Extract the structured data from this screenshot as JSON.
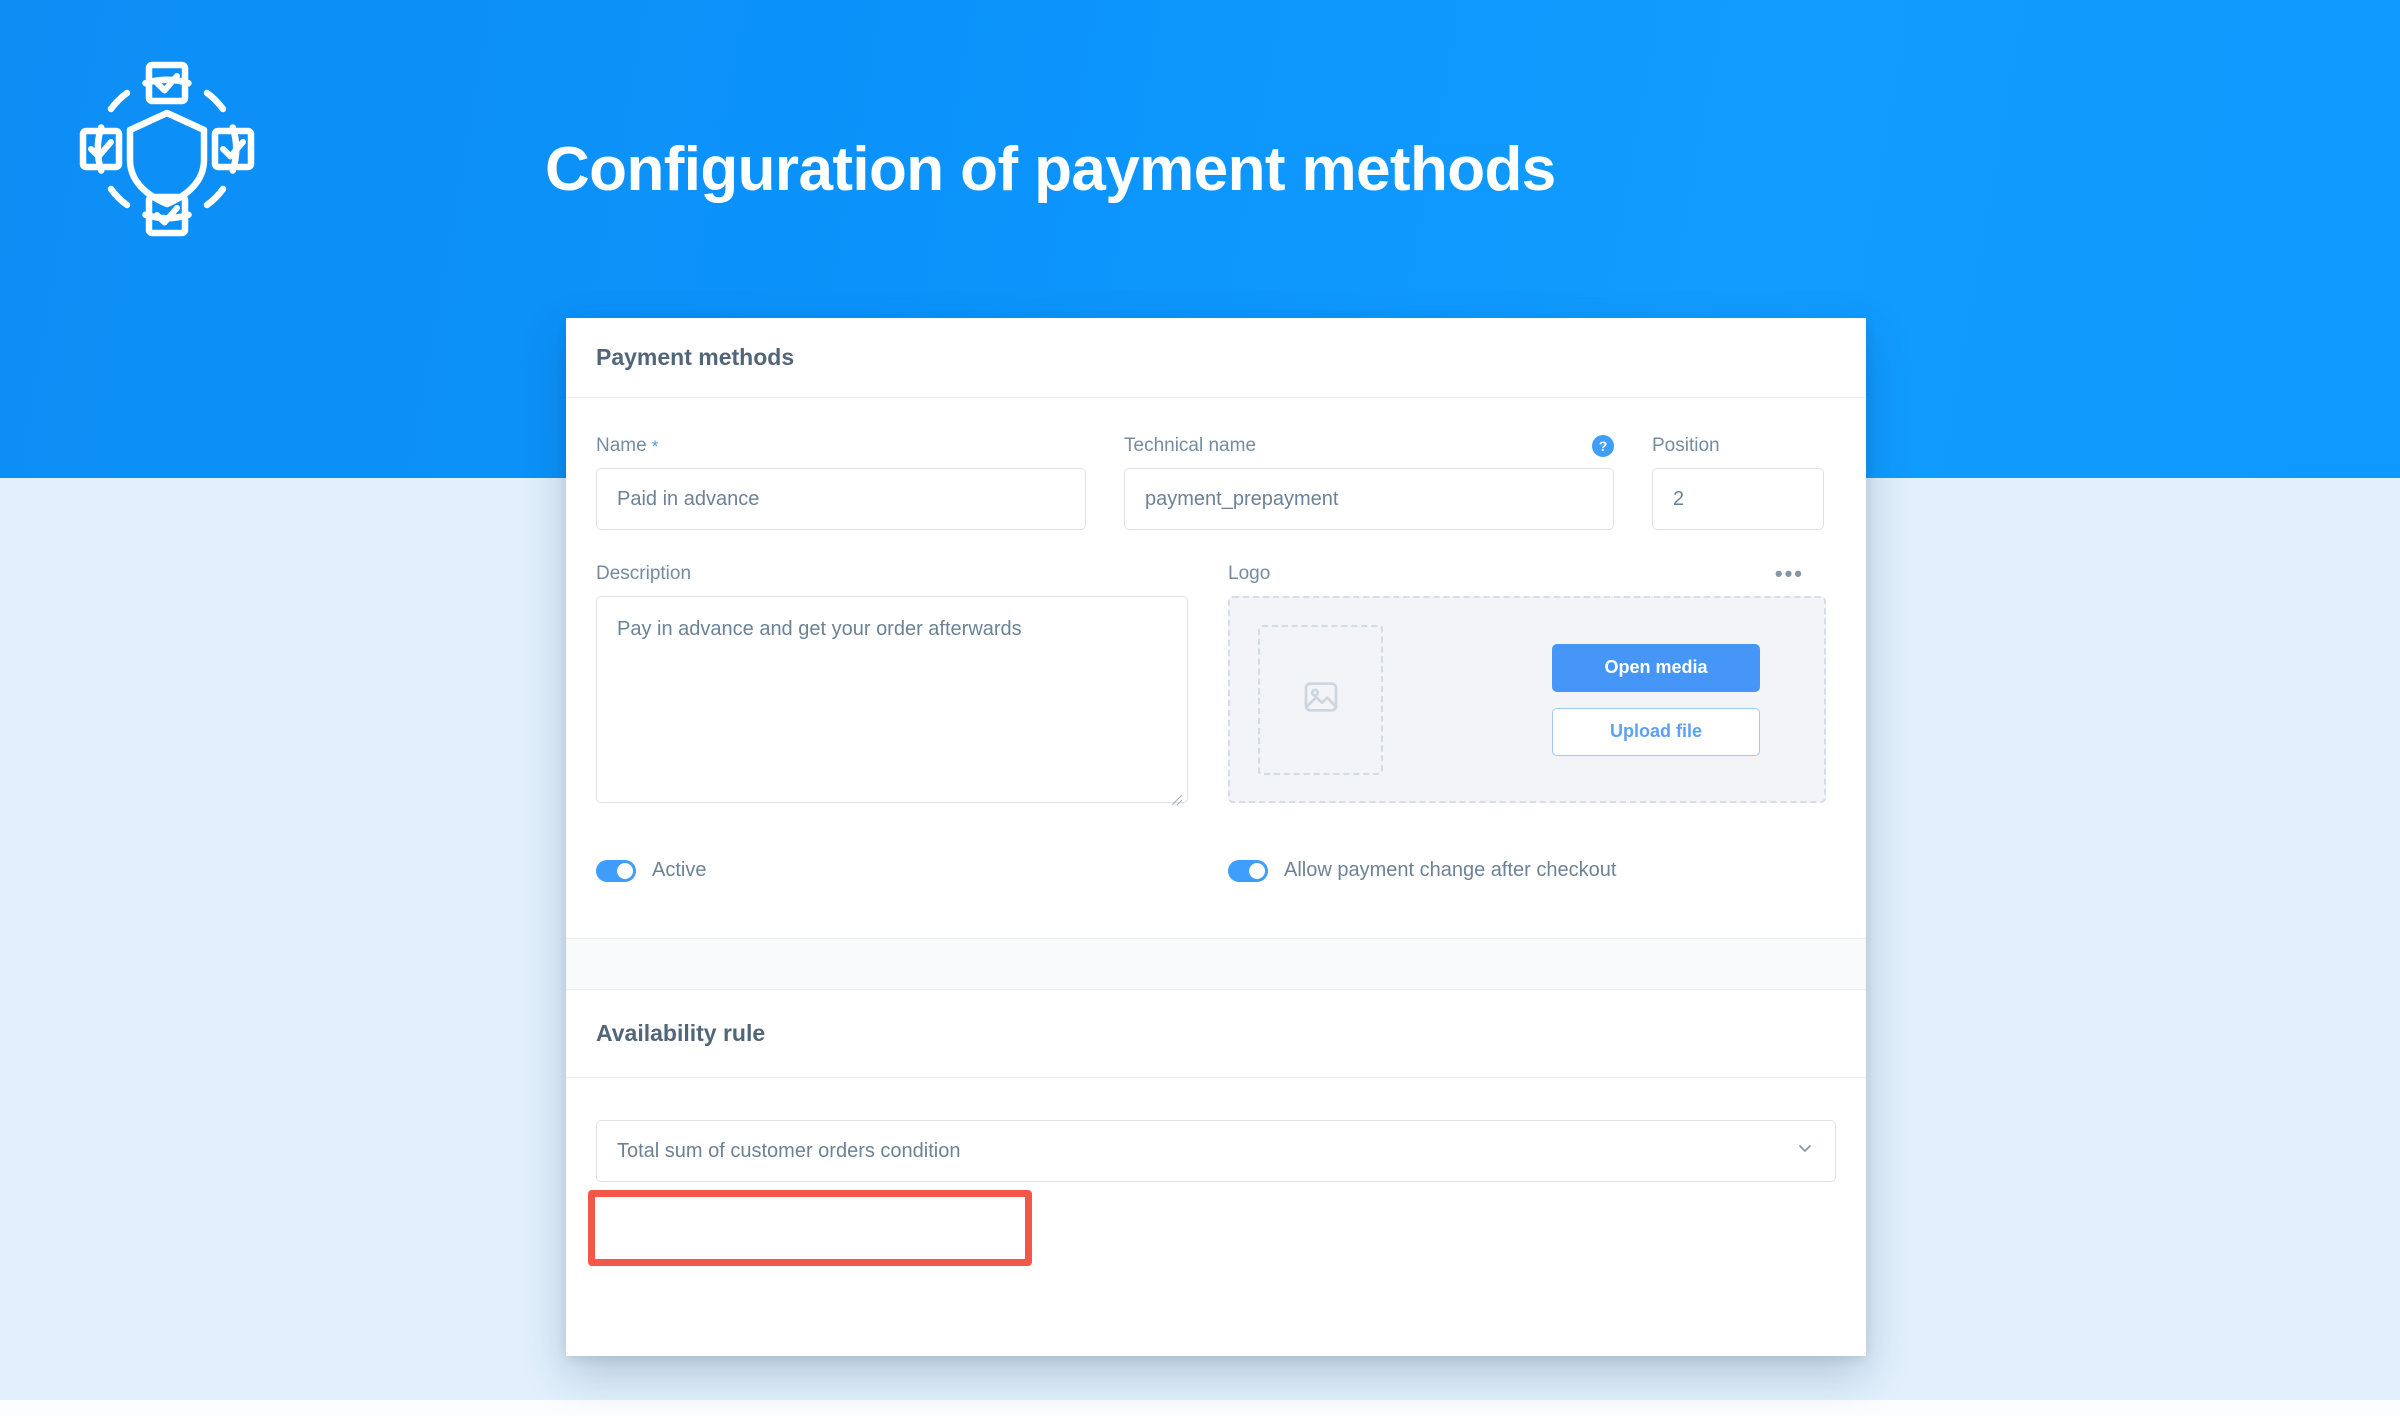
{
  "header": {
    "title": "Configuration of payment methods",
    "logo_icon": "shield-checkbox-circle-icon",
    "background_color": "#0b93fb",
    "title_color": "#ffffff"
  },
  "page": {
    "background_color": "#e1f0fc"
  },
  "card": {
    "title": "Payment methods",
    "fields": {
      "name": {
        "label": "Name",
        "required_marker": "*",
        "value": "Paid in advance"
      },
      "technical_name": {
        "label": "Technical name",
        "value": "payment_prepayment",
        "help_icon": "question-mark-icon",
        "help_glyph": "?"
      },
      "position": {
        "label": "Position",
        "value": "2"
      },
      "description": {
        "label": "Description",
        "value": "Pay in advance and get your order afterwards"
      },
      "logo": {
        "label": "Logo",
        "more_icon": "ellipsis-icon",
        "more_glyph": "•••",
        "placeholder_icon": "image-placeholder-icon",
        "open_media_label": "Open media",
        "upload_file_label": "Upload file",
        "primary_color": "#4696f7",
        "secondary_text_color": "#5aa2f8"
      }
    },
    "toggles": [
      {
        "label": "Active",
        "state": "on",
        "color": "#3f9dfb"
      },
      {
        "label": "Allow payment change after checkout",
        "state": "on",
        "color": "#3f9dfb"
      }
    ]
  },
  "availability_rule": {
    "title": "Availability rule",
    "select": {
      "value": "Total sum of customer orders condition",
      "chevron_icon": "chevron-down-icon"
    },
    "highlight_color": "#f2574a"
  }
}
